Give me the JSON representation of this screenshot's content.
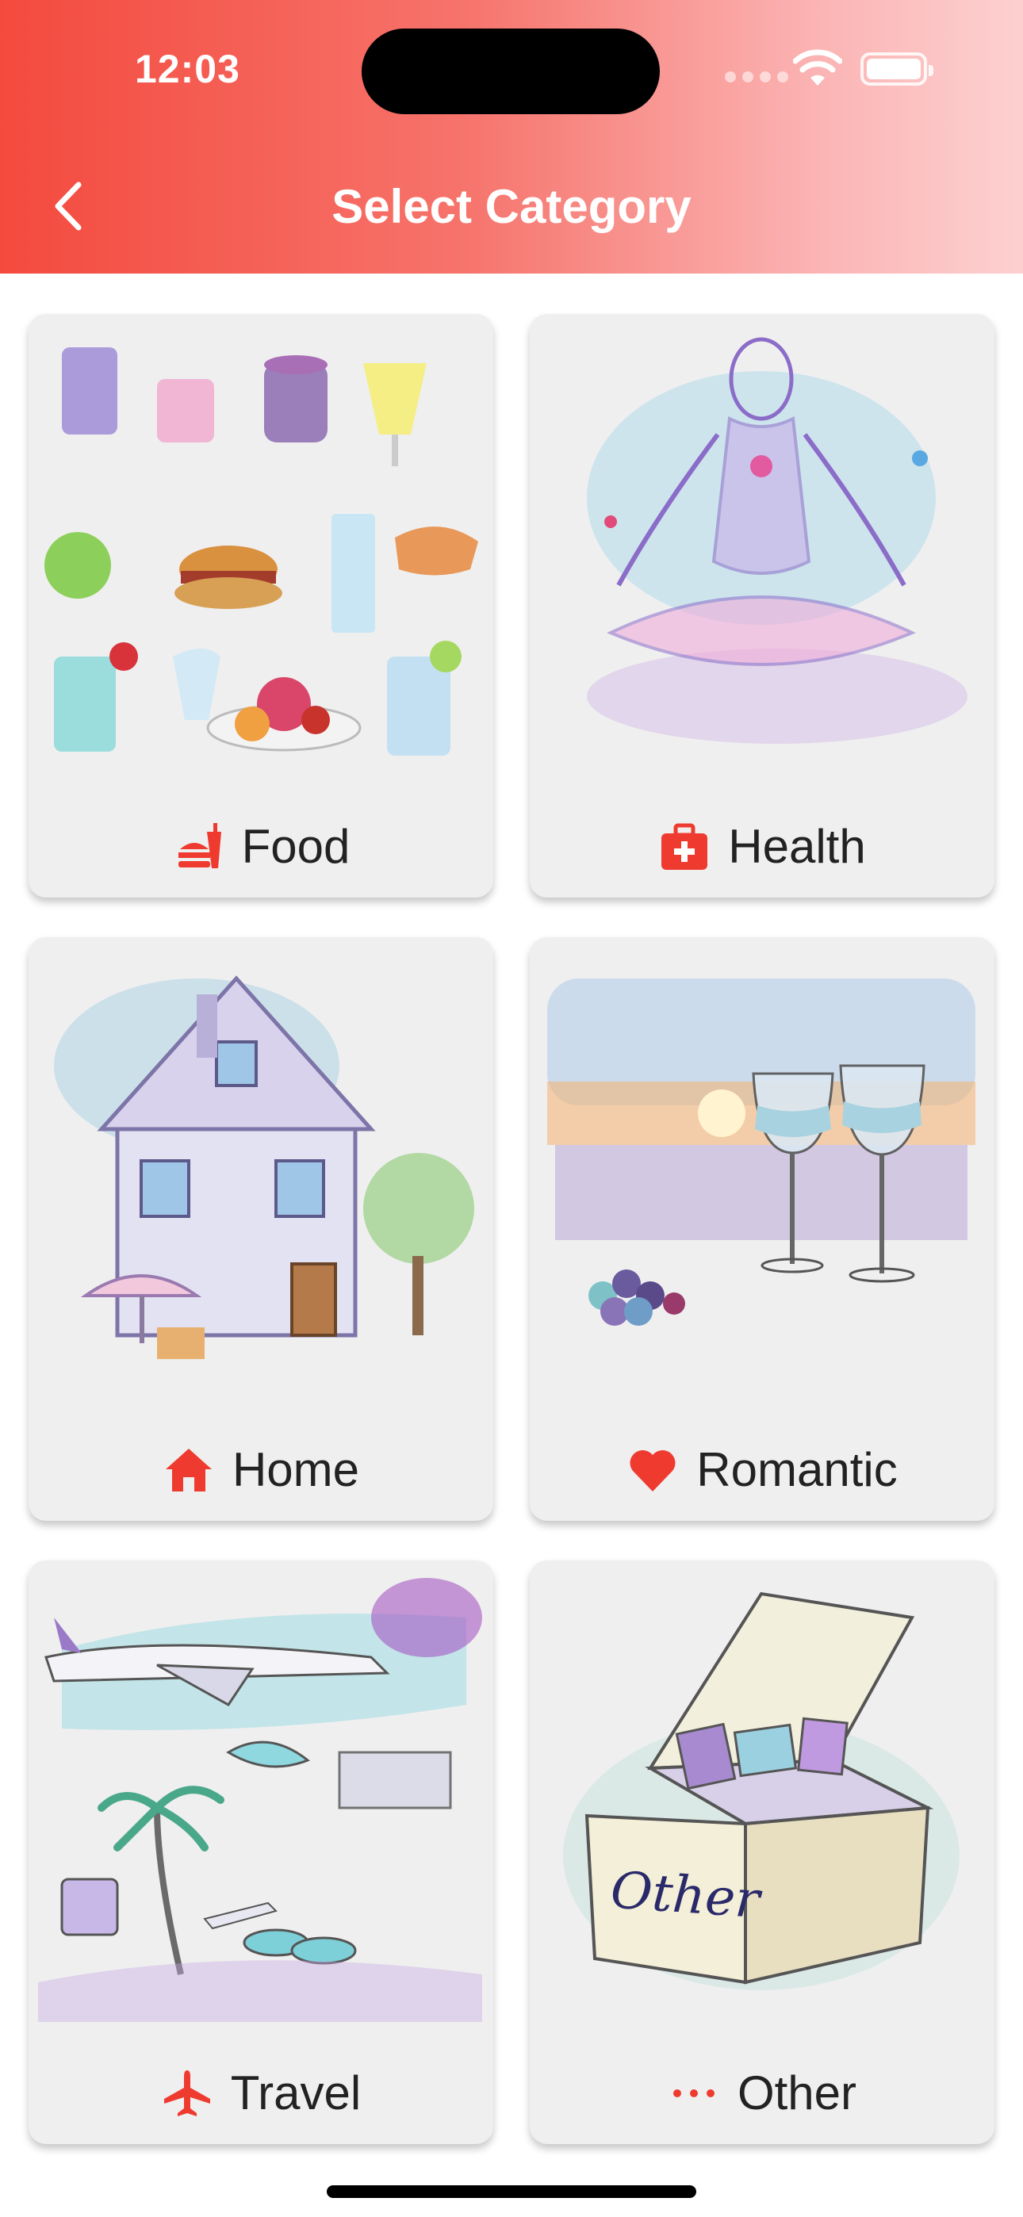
{
  "status_bar": {
    "time": "12:03"
  },
  "header": {
    "title": "Select Category"
  },
  "categories": [
    {
      "label": "Food",
      "icon": "food-icon"
    },
    {
      "label": "Health",
      "icon": "medkit-icon"
    },
    {
      "label": "Home",
      "icon": "home-icon"
    },
    {
      "label": "Romantic",
      "icon": "heart-icon"
    },
    {
      "label": "Travel",
      "icon": "airplane-icon"
    },
    {
      "label": "Other",
      "icon": "ellipsis-icon"
    }
  ],
  "colors": {
    "accent": "#ef3b2f",
    "header_start": "#f44a3e",
    "header_end": "#fdd0d0",
    "card_bg": "#efefef"
  }
}
